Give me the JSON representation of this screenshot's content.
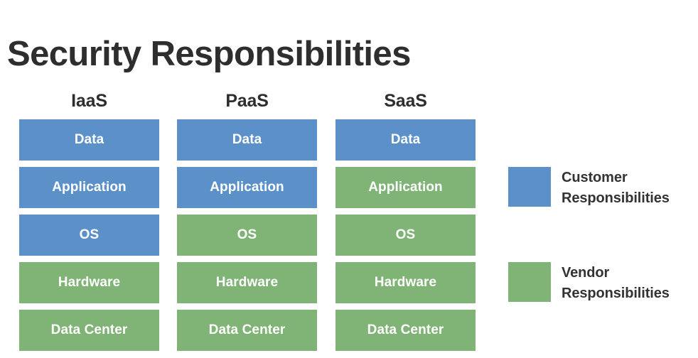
{
  "title": "Security Responsibilities",
  "colors": {
    "customer": "#5b91c8",
    "vendor": "#80b376",
    "text_dark": "#2e2e2e",
    "box_text": "#ffffff",
    "background": "#ffffff"
  },
  "columns": [
    {
      "header": "IaaS",
      "layers": [
        {
          "label": "Data",
          "owner": "customer"
        },
        {
          "label": "Application",
          "owner": "customer"
        },
        {
          "label": "OS",
          "owner": "customer"
        },
        {
          "label": "Hardware",
          "owner": "vendor"
        },
        {
          "label": "Data Center",
          "owner": "vendor"
        }
      ]
    },
    {
      "header": "PaaS",
      "layers": [
        {
          "label": "Data",
          "owner": "customer"
        },
        {
          "label": "Application",
          "owner": "customer"
        },
        {
          "label": "OS",
          "owner": "vendor"
        },
        {
          "label": "Hardware",
          "owner": "vendor"
        },
        {
          "label": "Data Center",
          "owner": "vendor"
        }
      ]
    },
    {
      "header": "SaaS",
      "layers": [
        {
          "label": "Data",
          "owner": "customer"
        },
        {
          "label": "Application",
          "owner": "vendor"
        },
        {
          "label": "OS",
          "owner": "vendor"
        },
        {
          "label": "Hardware",
          "owner": "vendor"
        },
        {
          "label": "Data Center",
          "owner": "vendor"
        }
      ]
    }
  ],
  "legend": [
    {
      "label": "Customer\nResponsibilities",
      "owner": "customer"
    },
    {
      "label": "Vendor\nResponsibilities",
      "owner": "vendor"
    }
  ]
}
